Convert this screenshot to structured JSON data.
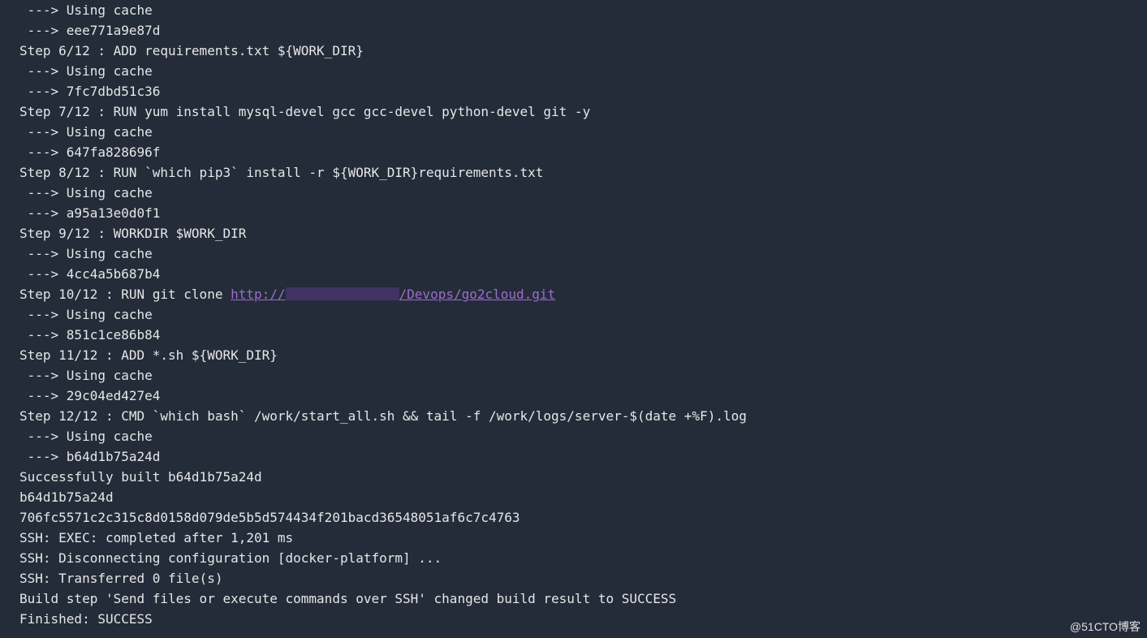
{
  "log": {
    "lines": [
      {
        "kind": "text",
        "text": " ---> Using cache"
      },
      {
        "kind": "text",
        "text": " ---> eee771a9e87d"
      },
      {
        "kind": "text",
        "text": "Step 6/12 : ADD requirements.txt ${WORK_DIR}"
      },
      {
        "kind": "text",
        "text": " ---> Using cache"
      },
      {
        "kind": "text",
        "text": " ---> 7fc7dbd51c36"
      },
      {
        "kind": "text",
        "text": "Step 7/12 : RUN yum install mysql-devel gcc gcc-devel python-devel git -y"
      },
      {
        "kind": "text",
        "text": " ---> Using cache"
      },
      {
        "kind": "text",
        "text": " ---> 647fa828696f"
      },
      {
        "kind": "text",
        "text": "Step 8/12 : RUN `which pip3` install -r ${WORK_DIR}requirements.txt"
      },
      {
        "kind": "text",
        "text": " ---> Using cache"
      },
      {
        "kind": "text",
        "text": " ---> a95a13e0d0f1"
      },
      {
        "kind": "text",
        "text": "Step 9/12 : WORKDIR $WORK_DIR"
      },
      {
        "kind": "text",
        "text": " ---> Using cache"
      },
      {
        "kind": "text",
        "text": " ---> 4cc4a5b687b4"
      },
      {
        "kind": "link",
        "prefix": "Step 10/12 : RUN git clone ",
        "url_prefix": "http://",
        "url_suffix": "/Devops/go2cloud.git"
      },
      {
        "kind": "text",
        "text": " ---> Using cache"
      },
      {
        "kind": "text",
        "text": " ---> 851c1ce86b84"
      },
      {
        "kind": "text",
        "text": "Step 11/12 : ADD *.sh ${WORK_DIR}"
      },
      {
        "kind": "text",
        "text": " ---> Using cache"
      },
      {
        "kind": "text",
        "text": " ---> 29c04ed427e4"
      },
      {
        "kind": "text",
        "text": "Step 12/12 : CMD `which bash` /work/start_all.sh && tail -f /work/logs/server-$(date +%F).log"
      },
      {
        "kind": "text",
        "text": " ---> Using cache"
      },
      {
        "kind": "text",
        "text": " ---> b64d1b75a24d"
      },
      {
        "kind": "text",
        "text": "Successfully built b64d1b75a24d"
      },
      {
        "kind": "text",
        "text": "b64d1b75a24d"
      },
      {
        "kind": "text",
        "text": "706fc5571c2c315c8d0158d079de5b5d574434f201bacd36548051af6c7c4763"
      },
      {
        "kind": "text",
        "text": "SSH: EXEC: completed after 1,201 ms"
      },
      {
        "kind": "text",
        "text": "SSH: Disconnecting configuration [docker-platform] ..."
      },
      {
        "kind": "text",
        "text": "SSH: Transferred 0 file(s)"
      },
      {
        "kind": "text",
        "text": "Build step 'Send files or execute commands over SSH' changed build result to SUCCESS"
      },
      {
        "kind": "text",
        "text": "Finished: SUCCESS"
      }
    ]
  },
  "watermark": "@51CTO博客"
}
